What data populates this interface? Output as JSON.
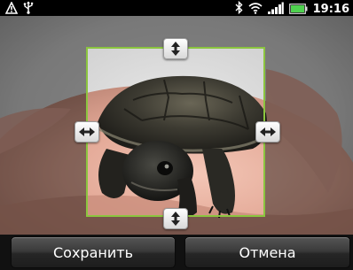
{
  "status_bar": {
    "time": "19:16",
    "icons": [
      "warning-icon",
      "usb-icon",
      "bluetooth-icon",
      "wifi-icon",
      "signal-icon",
      "battery-icon"
    ],
    "battery_color": "#4fd14f"
  },
  "crop": {
    "frame_color": "#8bc53f",
    "handles": [
      "top-handle",
      "bottom-handle",
      "left-handle",
      "right-handle"
    ]
  },
  "buttons": {
    "save_label": "Сохранить",
    "cancel_label": "Отмена"
  }
}
